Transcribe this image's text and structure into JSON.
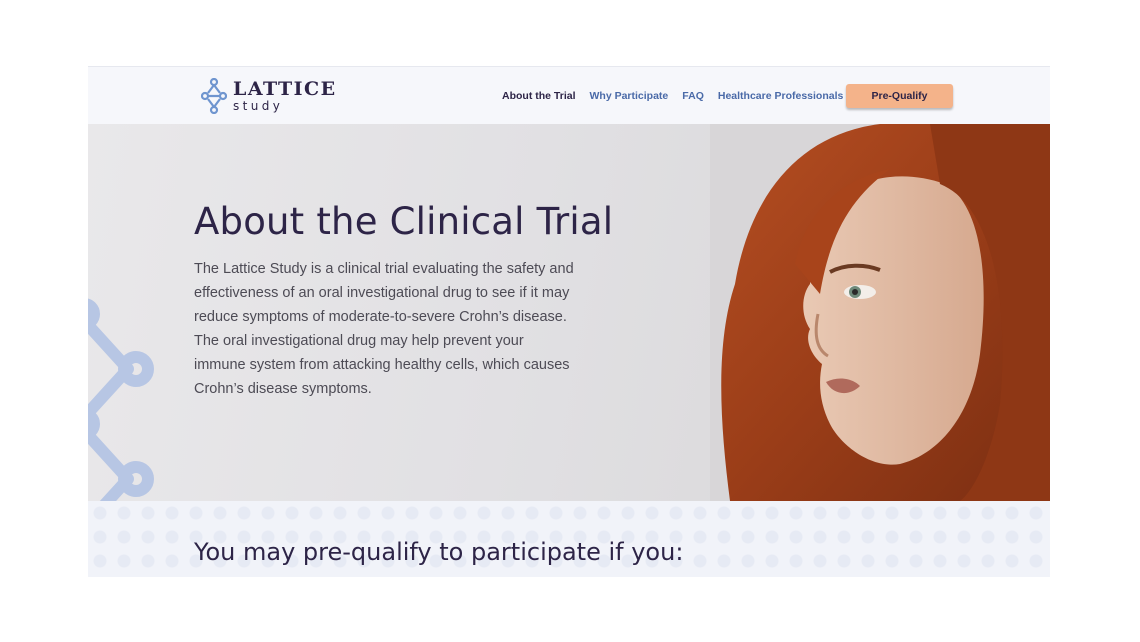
{
  "brand": {
    "name": "LATTICE",
    "tagline": "study"
  },
  "nav": {
    "items": [
      {
        "label": "About the Trial",
        "active": true
      },
      {
        "label": "Why Participate",
        "active": false
      },
      {
        "label": "FAQ",
        "active": false
      },
      {
        "label": "Healthcare Professionals",
        "active": false
      }
    ],
    "cta_label": "Pre-Qualify"
  },
  "hero": {
    "title": "About the Clinical Trial",
    "body": "The Lattice Study is a clinical trial evaluating the safety and effectiveness of an oral investigational drug to see if it may reduce symptoms of moderate-to-severe Crohn’s disease. The oral investigational drug may help prevent your immune system from attacking healthy cells, which causes Crohn’s disease symptoms."
  },
  "qualify": {
    "title": "You may pre-qualify to participate if you:"
  },
  "colors": {
    "navy": "#2d2447",
    "link_blue": "#4a6aa8",
    "cta_orange": "#f4b38a",
    "pattern_blue": "#b7c6e4"
  }
}
